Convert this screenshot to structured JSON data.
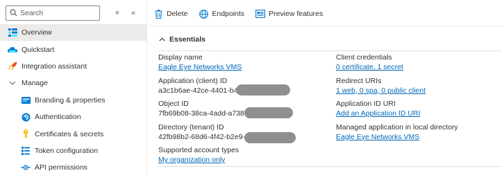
{
  "sidebar": {
    "search_placeholder": "Search",
    "clear_icon": "×",
    "collapse_icon": "«",
    "items": [
      {
        "label": "Overview",
        "icon": "overview-icon",
        "active": true
      },
      {
        "label": "Quickstart",
        "icon": "quickstart-icon"
      },
      {
        "label": "Integration assistant",
        "icon": "rocket-icon"
      },
      {
        "label": "Manage",
        "icon": "chevron-down-icon"
      },
      {
        "label": "Branding & properties",
        "icon": "branding-icon"
      },
      {
        "label": "Authentication",
        "icon": "authentication-icon"
      },
      {
        "label": "Certificates & secrets",
        "icon": "key-icon"
      },
      {
        "label": "Token configuration",
        "icon": "token-icon"
      },
      {
        "label": "API permissions",
        "icon": "api-permissions-icon"
      }
    ]
  },
  "toolbar": {
    "delete_label": "Delete",
    "endpoints_label": "Endpoints",
    "preview_label": "Preview features"
  },
  "essentials": {
    "title": "Essentials",
    "left": [
      {
        "label": "Display name",
        "value": "Eagle Eye Networks VMS",
        "link": true
      },
      {
        "label": "Application (client) ID",
        "value": "a3c1b6ae-42ce-4401-b48",
        "redacted": true
      },
      {
        "label": "Object ID",
        "value": "7fb69b08-38ca-4add-a738-c",
        "redacted": true
      },
      {
        "label": "Directory (tenant) ID",
        "value": "42fb98b2-68d6-4f42-b2e9-9",
        "redacted": true
      },
      {
        "label": "Supported account types",
        "value": "My organization only",
        "link": true
      }
    ],
    "right": [
      {
        "label": "Client credentials",
        "value": "0 certificate, 1 secret",
        "link": true
      },
      {
        "label": "Redirect URIs",
        "value": "1 web, 0 spa, 0 public client",
        "link": true
      },
      {
        "label": "Application ID URI",
        "value": "Add an Application ID URI",
        "link": true
      },
      {
        "label": "Managed application in local directory",
        "value": "Eagle Eye Networks VMS",
        "link": true
      }
    ]
  },
  "colors": {
    "link": "#0067b8",
    "active_nav": "#edebe9",
    "accent": "#0078d4"
  }
}
